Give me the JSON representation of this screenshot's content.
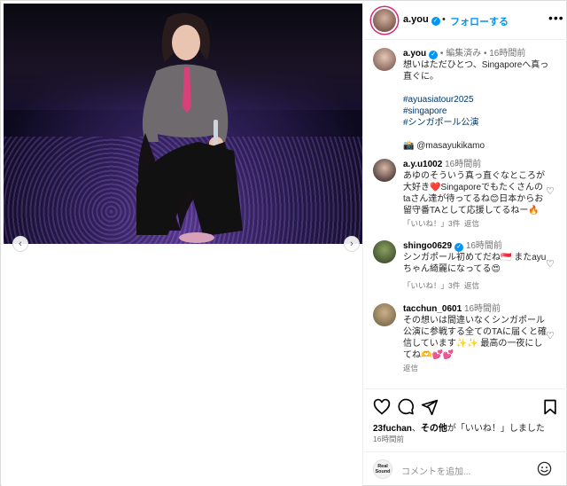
{
  "post": {
    "username": "a.you",
    "follow_label": "フォローする",
    "separator": "•",
    "more_label": "•••"
  },
  "caption": {
    "username": "a.you",
    "edited": "編集済み",
    "time": "16時間前",
    "text": "想いはただひとつ、Singaporeへ真っ直ぐに。",
    "hashtags": [
      "#ayuasiatour2025",
      "#singapore",
      "#シンガポール公演"
    ],
    "credit": "📸 @masayukikamo"
  },
  "comments": [
    {
      "username": "a.y.u1002",
      "time": "16時間前",
      "text": "あゆのそういう真っ直ぐなところが大好き❤️Singaporeでもたくさんのtaさん達が待ってるね😊日本からお留守番TAとして応援してるねー🔥",
      "likes": "「いいね！」3件",
      "reply": "返信"
    },
    {
      "username": "shingo0629",
      "verified": true,
      "time": "16時間前",
      "text": "シンガポール初めてだね🇸🇬 またayuちゃん綺麗になってる😍",
      "likes": "「いいね！」3件",
      "reply": "返信"
    },
    {
      "username": "tacchun_0601",
      "time": "16時間前",
      "text": "その想いは間違いなくシンガポール公演に参戦する全てのTAに届くと確信しています✨✨ 最高の一夜にしてね🫶💕💕",
      "reply": "返信"
    }
  ],
  "footer": {
    "likes_user": "23fuchan",
    "likes_others": "その他",
    "likes_suffix": "が「いいね！」しました",
    "time": "16時間前",
    "add_comment_placeholder": "コメントを追加...",
    "commenter_avatar_text": "Real Sound"
  },
  "icons": {
    "like": "heart-icon",
    "comment": "comment-icon",
    "share": "send-icon",
    "save": "bookmark-icon",
    "emoji": "emoji-icon",
    "prev": "chevron-left-icon",
    "next": "chevron-right-icon"
  },
  "colors": {
    "link": "#0095f6",
    "hashtag": "#00376b",
    "secondary": "#737373",
    "border": "#dbdbdb"
  }
}
